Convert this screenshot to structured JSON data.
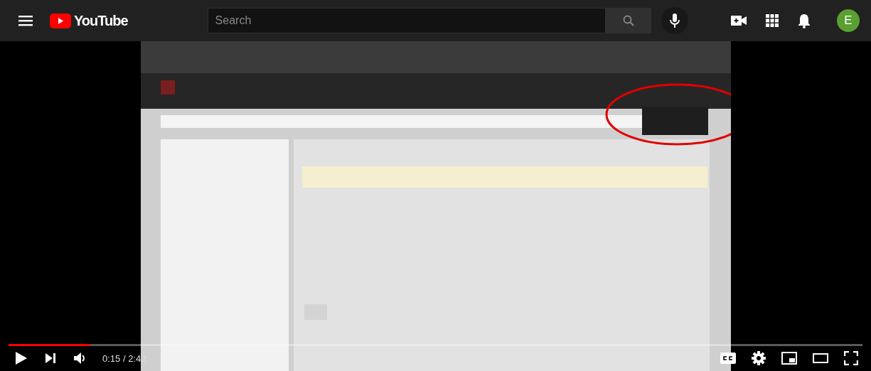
{
  "masthead": {
    "logo": "YouTube",
    "search": {
      "placeholder": "Search"
    },
    "avatar": "E"
  },
  "player": {
    "progress": {
      "level": 0.096
    },
    "time": "0:15 / 2:42"
  }
}
